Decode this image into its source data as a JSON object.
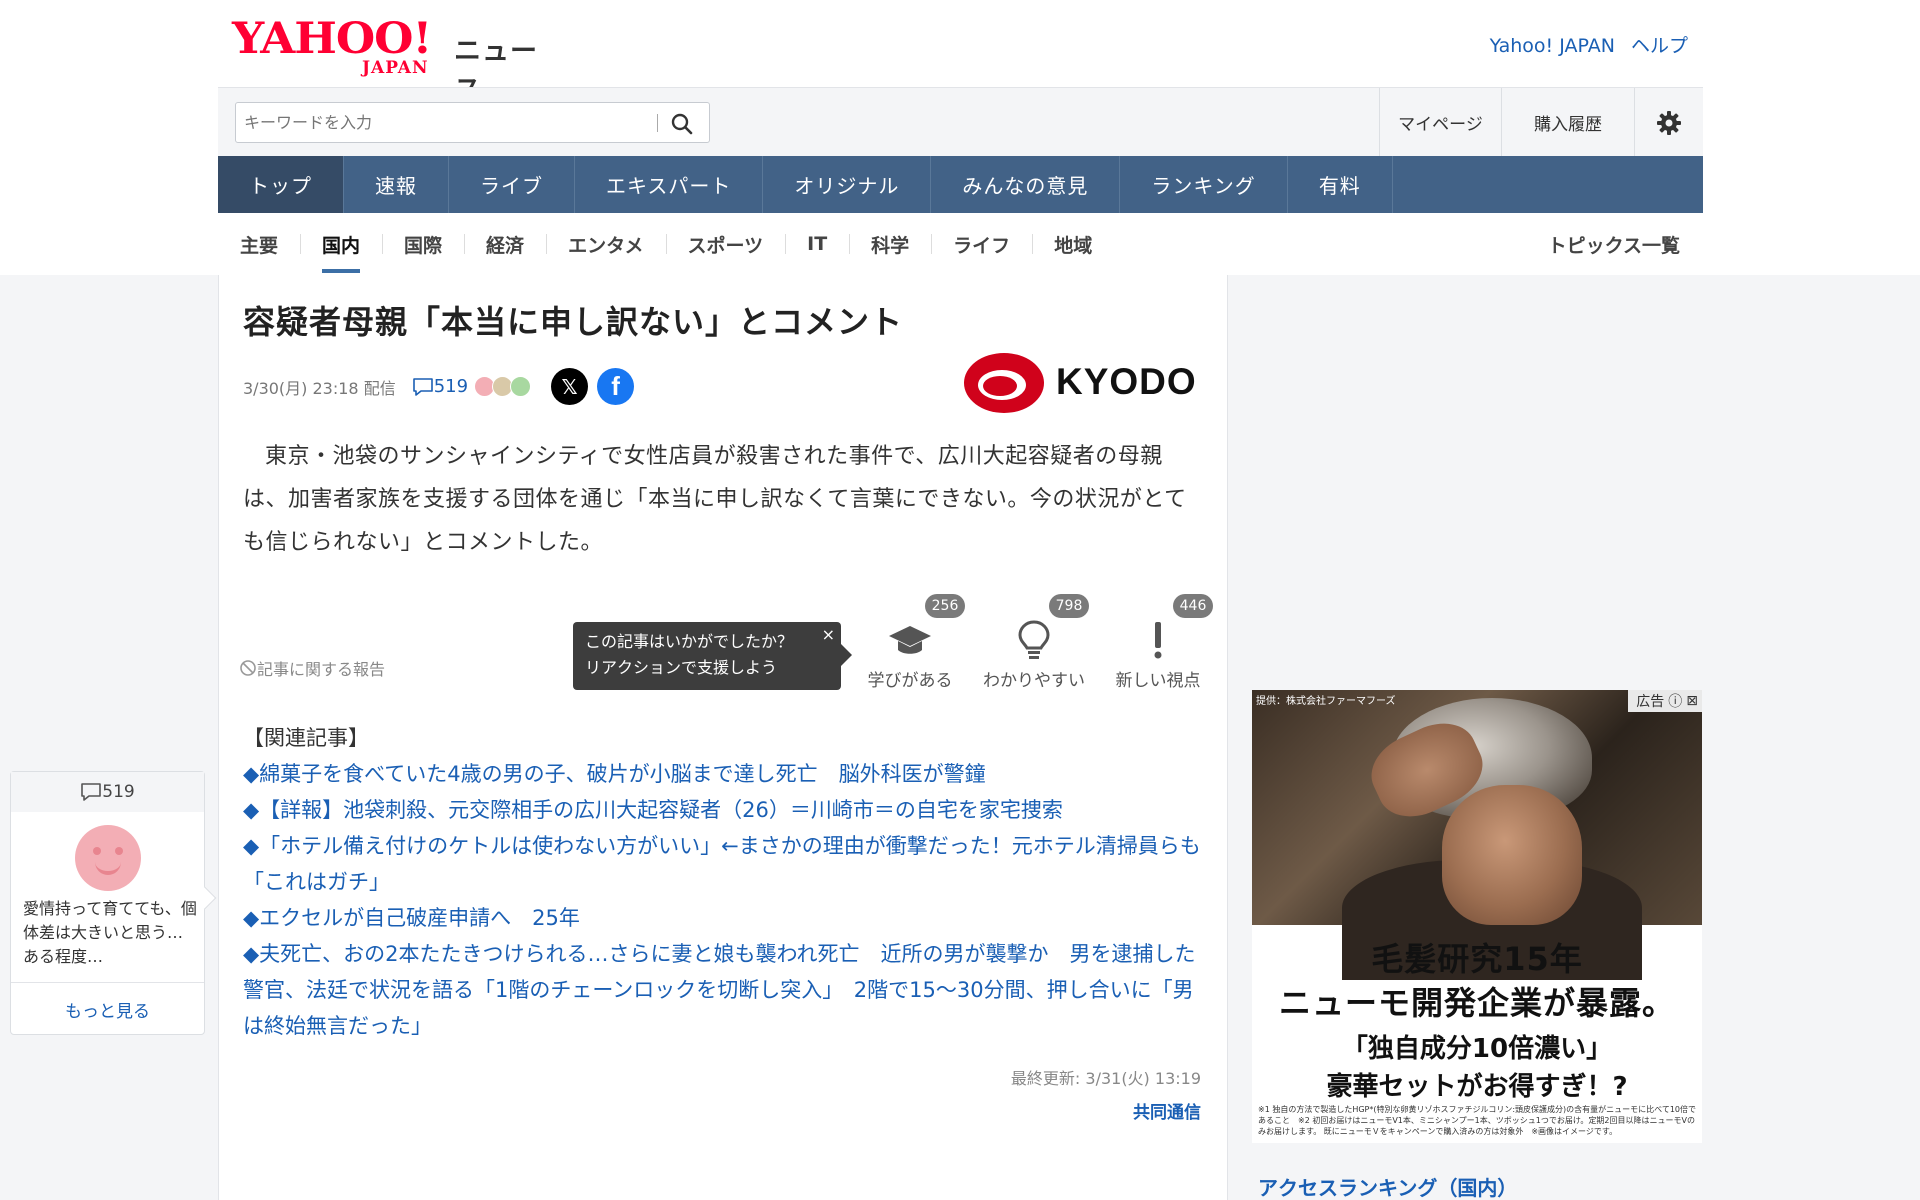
{
  "header": {
    "logo_text": "YAHOO!",
    "logo_sub": "JAPAN",
    "service": "ニュース",
    "links": [
      "Yahoo! JAPAN",
      "ヘルプ"
    ]
  },
  "search": {
    "placeholder": "キーワードを入力",
    "utilities": [
      "マイページ",
      "購入履歴"
    ]
  },
  "global_nav": [
    "トップ",
    "速報",
    "ライブ",
    "エキスパート",
    "オリジナル",
    "みんなの意見",
    "ランキング",
    "有料"
  ],
  "sub_nav": [
    "主要",
    "国内",
    "国際",
    "経済",
    "エンタメ",
    "スポーツ",
    "IT",
    "科学",
    "ライフ",
    "地域"
  ],
  "sub_nav_active": "国内",
  "topics_link": "トピックス一覧",
  "article": {
    "title": "容疑者母親「本当に申し訳ない」とコメント",
    "date": "3/30(月) 23:18 配信",
    "comment_count": "519",
    "source_logo": "KYODO",
    "body": "東京・池袋のサンシャインシティで女性店員が殺害された事件で、広川大起容疑者の母親は、加害者家族を支援する団体を通じ「本当に申し訳なくて言葉にできない。今の状況がとても信じられない」とコメントした。",
    "report_link": "記事に関する報告",
    "tooltip_line1": "この記事はいかがでしたか？",
    "tooltip_line2": "リアクションで支援しよう",
    "reactions": [
      {
        "label": "学びがある",
        "count": "256",
        "icon": "graduation-cap-icon"
      },
      {
        "label": "わかりやすい",
        "count": "798",
        "icon": "lightbulb-icon"
      },
      {
        "label": "新しい視点",
        "count": "446",
        "icon": "exclamation-icon"
      }
    ],
    "related_heading": "【関連記事】",
    "related": [
      "◆綿菓子を食べていた4歳の男の子、破片が小脳まで達し死亡　脳外科医が警鐘",
      "◆【詳報】池袋刺殺、元交際相手の広川大起容疑者（26）＝川崎市＝の自宅を家宅捜索",
      "◆「ホテル備え付けのケトルは使わない方がいい」←まさかの理由が衝撃だった！元ホテル清掃員らも「これはガチ」",
      "◆エクセルが自己破産申請へ　25年",
      "◆夫死亡、おの2本たたきつけられる…さらに妻と娘も襲われ死亡　近所の男が襲撃か　男を逮捕した警官、法廷で状況を語る「1階のチェーンロックを切断し突入」　2階で15～30分間、押し合いに「男は終始無言だった」"
    ],
    "updated": "最終更新: 3/31(火) 13:19",
    "source_name": "共同通信"
  },
  "comment_widget": {
    "count": "519",
    "preview": "愛情持って育てても、個体差は大きいと思う… ある程度…",
    "more": "もっと見る"
  },
  "ad": {
    "provider": "提供：株式会社ファーマフーズ",
    "label": "広告",
    "line1": "毛髪研究15年",
    "line2": "ニューモ開発企業が暴露。",
    "line3": "「独自成分10倍濃い」",
    "line4": "豪華セットがお得すぎ！?",
    "note": "※1 独自の方法で製造したHGP*(特別な卵黄リゾホスファチジルコリン:頭皮保護成分)の含有量がニューモに比べて10倍であること　※2 初回お届けはニューモV1本、ミニシャンプー1本、ツボッシュ1つでお届け。定期2回目以降はニューモVのみお届けします。 既にニューモＶをキャンペーンで購入済みの方は対象外　※画像はイメージです。"
  },
  "sidebar": {
    "ranking_title": "アクセスランキング（国内）"
  }
}
